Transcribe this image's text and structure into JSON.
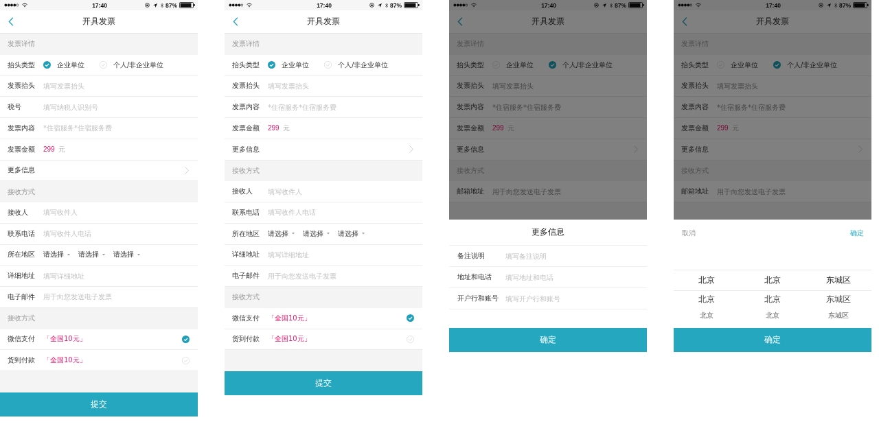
{
  "screens": [
    {
      "dimmed": false,
      "status_bar": {
        "time": "17:40",
        "battery": "87%"
      },
      "nav": {
        "title": "开具发票"
      },
      "rows": [
        {
          "kind": "section",
          "label": "发票详情"
        },
        {
          "kind": "radio",
          "label": "抬头类型",
          "options": [
            {
              "label": "企业单位",
              "selected": true
            },
            {
              "label": "个人/非企业单位",
              "selected": false
            }
          ]
        },
        {
          "kind": "input",
          "label": "发票抬头",
          "placeholder": "填写发票抬头"
        },
        {
          "kind": "input",
          "label": "税号",
          "placeholder": "填写纳税人识别号"
        },
        {
          "kind": "input",
          "label": "发票内容",
          "placeholder": "*住宿服务*住宿服务费"
        },
        {
          "kind": "amount",
          "label": "发票金额",
          "value": "299",
          "unit": "元"
        },
        {
          "kind": "link",
          "label": "更多信息"
        },
        {
          "kind": "section",
          "label": "接收方式"
        },
        {
          "kind": "input",
          "label": "接收人",
          "placeholder": "填写收件人"
        },
        {
          "kind": "input",
          "label": "联系电话",
          "placeholder": "填写收件人电话"
        },
        {
          "kind": "select",
          "label": "所在地区",
          "options": [
            "请选择",
            "请选择",
            "请选择"
          ]
        },
        {
          "kind": "input",
          "label": "详细地址",
          "placeholder": "填写详细地址"
        },
        {
          "kind": "input",
          "label": "电子邮件",
          "placeholder": "用于向您发送电子发票"
        },
        {
          "kind": "section",
          "label": "接收方式"
        },
        {
          "kind": "payment",
          "label": "微信支付",
          "price": "「全国10元」",
          "checked": true
        },
        {
          "kind": "payment",
          "label": "货到付款",
          "price": "「全国10元」",
          "checked": false
        }
      ],
      "submit_button": "提交"
    },
    {
      "dimmed": false,
      "status_bar": {
        "time": "17:40",
        "battery": "87%"
      },
      "nav": {
        "title": "开具发票"
      },
      "rows": [
        {
          "kind": "section",
          "label": "发票详情"
        },
        {
          "kind": "radio",
          "label": "抬头类型",
          "options": [
            {
              "label": "企业单位",
              "selected": true
            },
            {
              "label": "个人/非企业单位",
              "selected": false
            }
          ]
        },
        {
          "kind": "input",
          "label": "发票抬头",
          "placeholder": "填写发票抬头"
        },
        {
          "kind": "input",
          "label": "发票内容",
          "placeholder": "*住宿服务*住宿服务费"
        },
        {
          "kind": "amount",
          "label": "发票金额",
          "value": "299",
          "unit": "元"
        },
        {
          "kind": "link",
          "label": "更多信息"
        },
        {
          "kind": "section",
          "label": "接收方式"
        },
        {
          "kind": "input",
          "label": "接收人",
          "placeholder": "填写收件人"
        },
        {
          "kind": "input",
          "label": "联系电话",
          "placeholder": "填写收件人电话"
        },
        {
          "kind": "select",
          "label": "所在地区",
          "options": [
            "请选择",
            "请选择",
            "请选择"
          ]
        },
        {
          "kind": "input",
          "label": "详细地址",
          "placeholder": "填写详细地址"
        },
        {
          "kind": "input",
          "label": "电子邮件",
          "placeholder": "用于向您发送电子发票"
        },
        {
          "kind": "section",
          "label": "接收方式"
        },
        {
          "kind": "payment",
          "label": "微信支付",
          "price": "「全国10元」",
          "checked": true
        },
        {
          "kind": "payment",
          "label": "货到付款",
          "price": "「全国10元」",
          "checked": false
        }
      ],
      "submit_button": "提交"
    },
    {
      "dimmed": true,
      "status_bar": {
        "time": "17:40",
        "battery": "87%"
      },
      "nav": {
        "title": "开具发票"
      },
      "rows": [
        {
          "kind": "section",
          "label": "发票详情"
        },
        {
          "kind": "radio",
          "label": "抬头类型",
          "options": [
            {
              "label": "企业单位",
              "selected": false
            },
            {
              "label": "个人/非企业单位",
              "selected": true
            }
          ]
        },
        {
          "kind": "input",
          "label": "发票抬头",
          "placeholder": "填写发票抬头"
        },
        {
          "kind": "input",
          "label": "发票内容",
          "placeholder": "*住宿服务*住宿服务费"
        },
        {
          "kind": "amount",
          "label": "发票金额",
          "value": "299",
          "unit": "元"
        },
        {
          "kind": "link",
          "label": "更多信息"
        },
        {
          "kind": "section",
          "label": "接收方式"
        },
        {
          "kind": "input",
          "label": "邮箱地址",
          "placeholder": "用于向您发送电子发票"
        }
      ],
      "sheet": {
        "kind": "form",
        "title": "更多信息",
        "rows": [
          {
            "label": "备注说明",
            "placeholder": "填写备注说明"
          },
          {
            "label": "地址和电话",
            "placeholder": "填写地址和电话"
          },
          {
            "label": "开户行和账号",
            "placeholder": "填写开户行和账号"
          }
        ],
        "button": "确定"
      }
    },
    {
      "dimmed": true,
      "status_bar": {
        "time": "17:40",
        "battery": "87%"
      },
      "nav": {
        "title": "开具发票"
      },
      "rows": [
        {
          "kind": "section",
          "label": "发票详情"
        },
        {
          "kind": "radio",
          "label": "抬头类型",
          "options": [
            {
              "label": "企业单位",
              "selected": false
            },
            {
              "label": "个人/非企业单位",
              "selected": true
            }
          ]
        },
        {
          "kind": "input",
          "label": "发票抬头",
          "placeholder": "填写发票抬头"
        },
        {
          "kind": "input",
          "label": "发票内容",
          "placeholder": "*住宿服务*住宿服务费"
        },
        {
          "kind": "amount",
          "label": "发票金额",
          "value": "299",
          "unit": "元"
        },
        {
          "kind": "link",
          "label": "更多信息"
        },
        {
          "kind": "section",
          "label": "接收方式"
        },
        {
          "kind": "input",
          "label": "邮箱地址",
          "placeholder": "用于向您发送电子发票"
        }
      ],
      "sheet": {
        "kind": "picker",
        "cancel": "取消",
        "confirm": "确定",
        "rows": [
          {
            "cells": [
              "北京",
              "北京",
              "东城区"
            ],
            "selected": true
          },
          {
            "cells": [
              "北京",
              "北京",
              "东城区"
            ],
            "selected": false
          },
          {
            "cells": [
              "北京",
              "北京",
              "东城区"
            ],
            "selected": false
          }
        ],
        "button": "确定"
      }
    }
  ]
}
